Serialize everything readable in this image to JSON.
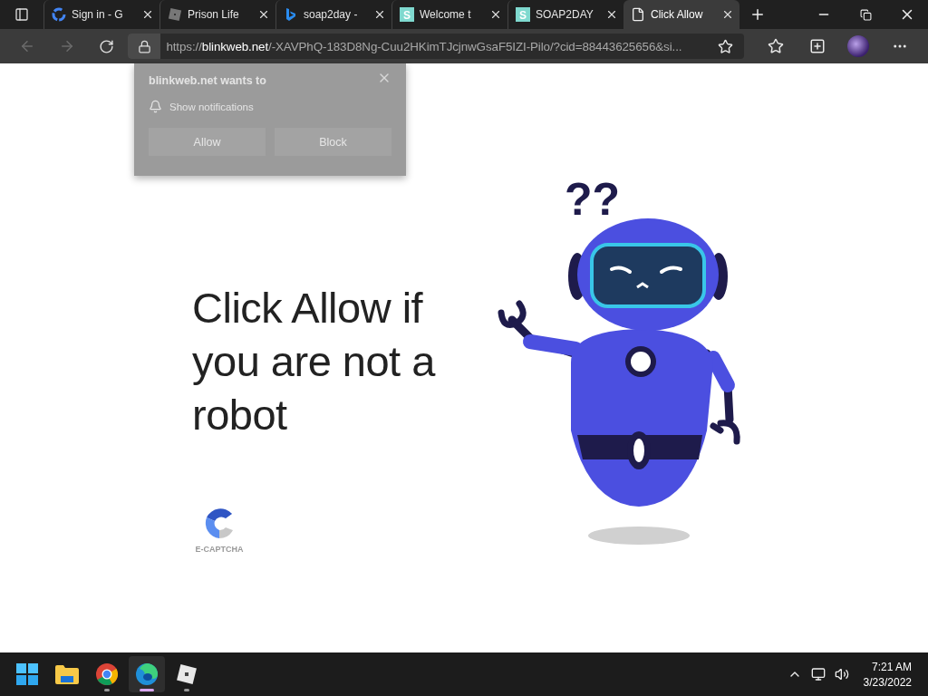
{
  "tabs": [
    {
      "label": "Sign in - G",
      "kind": "google",
      "selected": false
    },
    {
      "label": "Prison Life",
      "kind": "roblox",
      "selected": false
    },
    {
      "label": "soap2day -",
      "kind": "bing",
      "selected": false
    },
    {
      "label": "Welcome t",
      "kind": "letter",
      "letter": "S",
      "selected": false
    },
    {
      "label": "SOAP2DAY",
      "kind": "letter",
      "letter": "S",
      "selected": false
    },
    {
      "label": "Click Allow",
      "kind": "page",
      "selected": true
    }
  ],
  "nav": {
    "back_disabled": true,
    "forward_disabled": true
  },
  "address": {
    "scheme": "https://",
    "host": "blinkweb.net",
    "path": "/-XAVPhQ-183D8Ng-Cuu2HKimTJcjnwGsaF5IZI-Pilo/?cid=88443625656&si..."
  },
  "permission_popup": {
    "title": "blinkweb.net wants to",
    "permission": "Show notifications",
    "buttons": [
      "Allow",
      "Block"
    ]
  },
  "page": {
    "headline": "Click Allow if you are not a robot",
    "captcha_label": "E-CAPTCHA",
    "robot_marks": "??"
  },
  "taskbar": {
    "apps": [
      {
        "kind": "start",
        "selected": false,
        "running": false
      },
      {
        "kind": "explorer",
        "selected": false,
        "running": false
      },
      {
        "kind": "chrome",
        "selected": false,
        "running": true
      },
      {
        "kind": "edge",
        "selected": true,
        "running": true
      },
      {
        "kind": "roblox",
        "selected": false,
        "running": true
      }
    ],
    "time": "7:21 AM",
    "date": "3/23/2022"
  }
}
